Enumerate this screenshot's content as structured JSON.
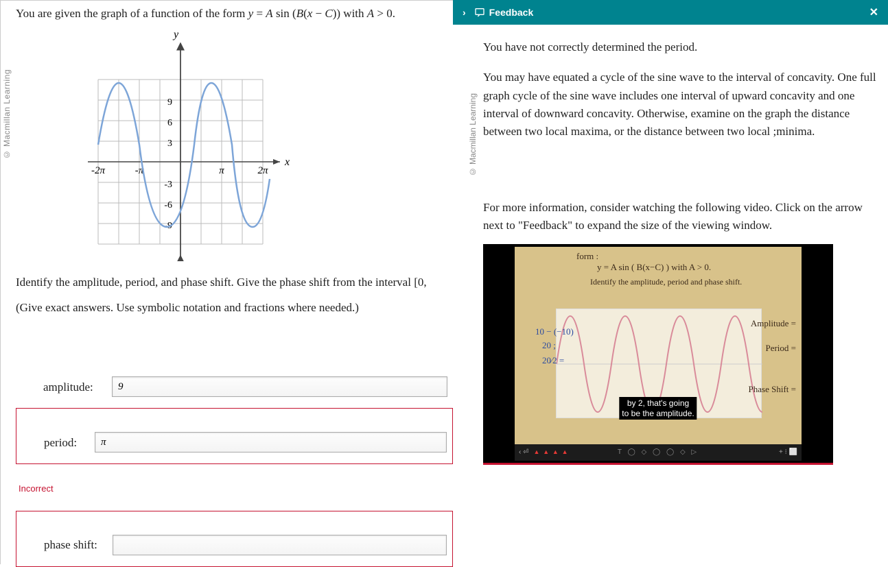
{
  "copyright": "© Macmillan Learning",
  "question": {
    "prompt_pre": "You are given the graph of a function of the form ",
    "prompt_eq_y": "y",
    "prompt_eq_eq": " = ",
    "prompt_eq_A": "A",
    "prompt_eq_sin": " sin (",
    "prompt_eq_B": "B",
    "prompt_eq_paren": "(",
    "prompt_eq_x": "x",
    "prompt_eq_minus": " − ",
    "prompt_eq_C": "C",
    "prompt_eq_close": ")) with ",
    "prompt_eq_A2": "A",
    "prompt_eq_gt": " > 0.",
    "instruction1": "Identify the amplitude, period, and phase shift. Give the phase shift from the interval [0,",
    "instruction2": "(Give exact answers. Use symbolic notation and fractions where needed.)"
  },
  "graph": {
    "x_ticks": [
      "-2π",
      "-π",
      "π",
      "2π"
    ],
    "y_ticks": [
      "9",
      "6",
      "3",
      "-3",
      "-6",
      "-9"
    ],
    "x_label": "x",
    "y_label": "y"
  },
  "answers": {
    "amplitude_label": "amplitude:",
    "amplitude_value": "9",
    "period_label": "period:",
    "period_value": "π",
    "phase_label": "phase shift:",
    "phase_value": "",
    "incorrect": "Incorrect"
  },
  "feedback": {
    "header_label": "Feedback",
    "p1": "You have not correctly determined the period.",
    "p2": "You may have equated a cycle of the sine wave to the interval of concavity. One full graph cycle of the sine wave includes one interval of upward concavity and one interval of downward concavity. Otherwise, examine on the graph the distance between two local maxima, or the distance between two local ;minima.",
    "video_info": "For more information, consider watching the following video. Click on the arrow next to \"Feedback\" to expand the size of the viewing window."
  },
  "video": {
    "hand_form": "form :",
    "hand_eq": "y = A sin ( B(x−C) )   with   A > 0.",
    "hand_identify": "Identify the amplitude, period and phase shift.",
    "left_calc1": "10 − (−10)",
    "left_calc2": "20 ;",
    "left_calc3": "20⁄2 =",
    "right_amp": "Amplitude =",
    "right_per": "Period =",
    "right_ps": "Phase Shift =",
    "caption1": "by 2, that's going",
    "caption2": "to be the amplitude.",
    "controls_left": "‹ ⏎",
    "controls_right": "+  ⁝  ⬜"
  }
}
